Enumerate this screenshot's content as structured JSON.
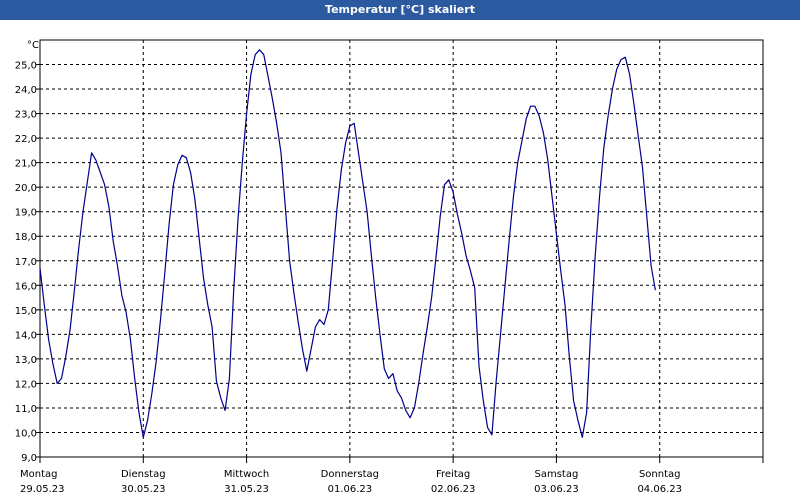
{
  "window": {
    "title": "Temperatur [°C] skaliert"
  },
  "chart_data": {
    "type": "line",
    "title": "Temperatur [°C] skaliert",
    "ylabel": "°C",
    "xlabel": "",
    "ylim": [
      9.0,
      26.0
    ],
    "y_ticks": [
      "25,0",
      "24,0",
      "23,0",
      "22,0",
      "21,0",
      "20,0",
      "19,0",
      "18,0",
      "17,0",
      "16,0",
      "15,0",
      "14,0",
      "13,0",
      "12,0",
      "11,0",
      "10,0",
      "9,0"
    ],
    "x_range_hours": [
      0,
      168
    ],
    "x_ticks": [
      {
        "day": "Montag",
        "date": "29.05.23"
      },
      {
        "day": "Dienstag",
        "date": "30.05.23"
      },
      {
        "day": "Mittwoch",
        "date": "31.05.23"
      },
      {
        "day": "Donnerstag",
        "date": "01.06.23"
      },
      {
        "day": "Freitag",
        "date": "02.06.23"
      },
      {
        "day": "Samstag",
        "date": "03.06.23"
      },
      {
        "day": "Sonntag",
        "date": "04.06.23"
      }
    ],
    "grid": true,
    "series": [
      {
        "color": "#00008b",
        "x_hours": [
          0,
          1,
          2,
          3,
          4,
          5,
          6,
          7,
          8,
          9,
          10,
          11,
          12,
          13,
          14,
          15,
          16,
          17,
          18,
          19,
          20,
          21,
          22,
          23,
          24,
          25,
          26,
          27,
          28,
          29,
          30,
          31,
          32,
          33,
          34,
          35,
          36,
          37,
          38,
          39,
          40,
          41,
          42,
          43,
          44,
          45,
          46,
          47,
          48,
          49,
          50,
          51,
          52,
          53,
          54,
          55,
          56,
          57,
          58,
          59,
          60,
          61,
          62,
          63,
          64,
          65,
          66,
          67,
          68,
          69,
          70,
          71,
          72,
          73,
          74,
          75,
          76,
          77,
          78,
          79,
          80,
          81,
          82,
          83,
          84,
          85,
          86,
          87,
          88,
          89,
          90,
          91,
          92,
          93,
          94,
          95,
          96,
          97,
          98,
          99,
          100,
          101,
          102,
          103,
          104,
          105,
          106,
          107,
          108,
          109,
          110,
          111,
          112,
          113,
          114,
          115,
          116,
          117,
          118,
          119,
          120,
          121,
          122,
          123,
          124,
          125,
          126,
          127,
          128,
          129,
          130,
          131,
          132,
          133,
          134,
          135,
          136,
          137,
          138,
          139,
          140,
          141,
          142,
          143,
          144,
          145,
          146,
          147,
          148,
          149,
          150,
          151,
          152,
          153,
          154,
          155,
          156,
          157,
          158,
          159,
          160,
          161,
          162,
          163,
          164,
          165,
          166,
          167,
          168
        ],
        "values": [
          16.7,
          15.2,
          13.8,
          12.8,
          12.0,
          12.2,
          13.1,
          14.2,
          15.8,
          17.5,
          19.0,
          20.2,
          21.4,
          21.1,
          20.6,
          20.1,
          19.2,
          17.8,
          16.8,
          15.6,
          14.9,
          13.8,
          12.2,
          10.8,
          9.8,
          10.5,
          11.6,
          12.9,
          14.6,
          16.5,
          18.5,
          20.1,
          20.9,
          21.3,
          21.2,
          20.6,
          19.5,
          17.9,
          16.3,
          15.2,
          14.3,
          12.1,
          11.4,
          10.9,
          12.2,
          15.8,
          18.7,
          21.0,
          23.0,
          24.6,
          25.4,
          25.6,
          25.4,
          24.5,
          23.6,
          22.6,
          21.4,
          19.2,
          17.0,
          15.7,
          14.5,
          13.4,
          12.5,
          13.4,
          14.3,
          14.6,
          14.4,
          15.0,
          17.0,
          19.1,
          20.7,
          21.8,
          22.5,
          22.6,
          21.4,
          20.2,
          19.0,
          17.2,
          15.5,
          14.0,
          12.6,
          12.2,
          12.4,
          11.7,
          11.4,
          10.9,
          10.6,
          11.0,
          12.0,
          13.2,
          14.3,
          15.5,
          17.1,
          18.8,
          20.1,
          20.3,
          19.8,
          18.9,
          18.1,
          17.2,
          16.6,
          15.9,
          12.7,
          11.3,
          10.2,
          9.9,
          12.1,
          14.0,
          15.9,
          17.8,
          19.6,
          21.0,
          21.9,
          22.8,
          23.3,
          23.3,
          22.9,
          22.2,
          21.1,
          19.6,
          18.1,
          16.6,
          15.2,
          13.1,
          11.3,
          10.5,
          9.8,
          10.8,
          14.3,
          17.2,
          19.6,
          21.6,
          22.9,
          24.0,
          24.8,
          25.2,
          25.3,
          24.6,
          23.4,
          22.1,
          20.8,
          18.8,
          16.8,
          15.8
        ]
      }
    ]
  }
}
